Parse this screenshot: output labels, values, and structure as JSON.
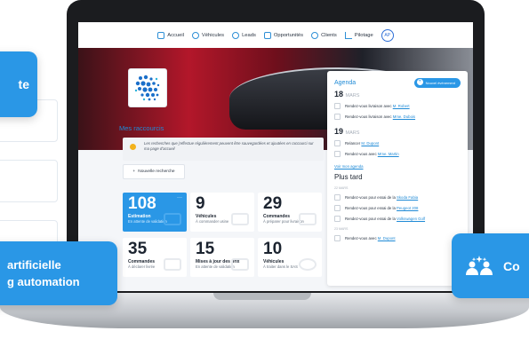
{
  "left_callouts": {
    "top_fragment": "te",
    "bottom_line1": "artificielle",
    "bottom_line2": "g automation"
  },
  "right_callout": {
    "fragment": "Co"
  },
  "nav": {
    "items": [
      {
        "label": "Accueil",
        "icon": "home-icon"
      },
      {
        "label": "Véhicules",
        "icon": "car-icon"
      },
      {
        "label": "Leads",
        "icon": "leads-icon"
      },
      {
        "label": "Opportunités",
        "icon": "opportunities-icon"
      },
      {
        "label": "Clients",
        "icon": "clients-icon"
      },
      {
        "label": "Pilotage",
        "icon": "chart-icon"
      }
    ],
    "avatar": "AP"
  },
  "shortcuts": {
    "title": "Mes raccourcis",
    "note": "Les recherches que j'effectue régulièrement peuvent être sauvegardées et ajoutées en raccourci sur ma page d'accueil",
    "new_search": "Nouvelle recherche"
  },
  "tiles": [
    {
      "num": "108",
      "label": "Estimation",
      "sub": "En attente de validation",
      "active": true
    },
    {
      "num": "9",
      "label": "Véhicules",
      "sub": "À commander usine",
      "active": false
    },
    {
      "num": "29",
      "label": "Commandes",
      "sub": "À préparer pour livraison",
      "active": false
    },
    {
      "num": "35",
      "label": "Commandes",
      "sub": "À déclarer livrée",
      "active": false
    },
    {
      "num": "15",
      "label": "Mises à jour des prix",
      "sub": "En attente de validation",
      "active": false
    },
    {
      "num": "10",
      "label": "Véhicules",
      "sub": "À traiter dans le SAS",
      "active": false
    }
  ],
  "agenda": {
    "title": "Agenda",
    "new_event": "Nouvel événement",
    "day1": {
      "num": "18",
      "month": "MARS"
    },
    "day1_items": [
      {
        "text": "Rendez-vous livraison avec ",
        "link": "M. Robert"
      },
      {
        "text": "Rendez-vous livraison avec ",
        "link": "Mme. Dubois"
      }
    ],
    "day2": {
      "num": "19",
      "month": "MARS"
    },
    "day2_items": [
      {
        "text": "Relancer ",
        "link": "M. Dupont"
      },
      {
        "text": "Rendez-vous avec ",
        "link": "Mme. Martin"
      }
    ],
    "see_all": "Voir mon agenda",
    "later": "Plus tard",
    "date_a": "22 MARS",
    "later_items": [
      {
        "text": "Rendez-vous pour essai de la ",
        "link": "Skoda Fabia"
      },
      {
        "text": "Rendez-vous pour essai de la ",
        "link": "Peugeot 208"
      },
      {
        "text": "Rendez-vous pour essai de la ",
        "link": "Volkswagen Golf"
      }
    ],
    "date_b": "23 MARS",
    "last_item": {
      "text": "Rendez-vous avec ",
      "link": "M. Dupont"
    }
  }
}
